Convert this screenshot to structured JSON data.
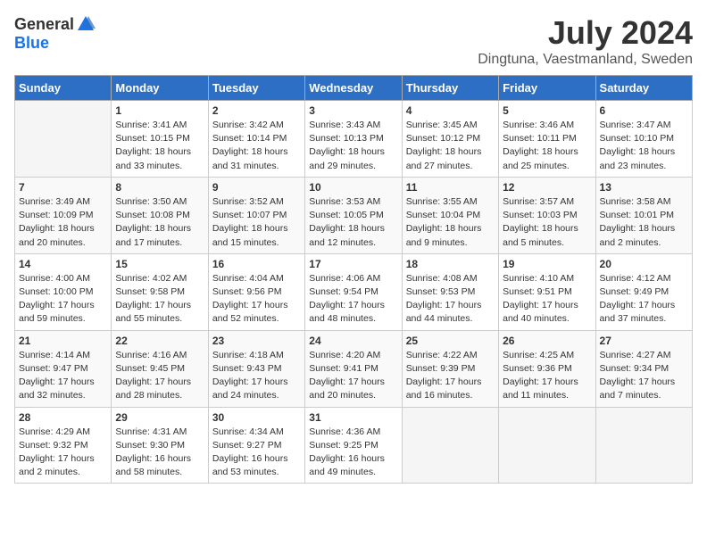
{
  "logo": {
    "general": "General",
    "blue": "Blue"
  },
  "title": "July 2024",
  "location": "Dingtuna, Vaestmanland, Sweden",
  "days_of_week": [
    "Sunday",
    "Monday",
    "Tuesday",
    "Wednesday",
    "Thursday",
    "Friday",
    "Saturday"
  ],
  "weeks": [
    [
      {
        "day": "",
        "info": ""
      },
      {
        "day": "1",
        "info": "Sunrise: 3:41 AM\nSunset: 10:15 PM\nDaylight: 18 hours\nand 33 minutes."
      },
      {
        "day": "2",
        "info": "Sunrise: 3:42 AM\nSunset: 10:14 PM\nDaylight: 18 hours\nand 31 minutes."
      },
      {
        "day": "3",
        "info": "Sunrise: 3:43 AM\nSunset: 10:13 PM\nDaylight: 18 hours\nand 29 minutes."
      },
      {
        "day": "4",
        "info": "Sunrise: 3:45 AM\nSunset: 10:12 PM\nDaylight: 18 hours\nand 27 minutes."
      },
      {
        "day": "5",
        "info": "Sunrise: 3:46 AM\nSunset: 10:11 PM\nDaylight: 18 hours\nand 25 minutes."
      },
      {
        "day": "6",
        "info": "Sunrise: 3:47 AM\nSunset: 10:10 PM\nDaylight: 18 hours\nand 23 minutes."
      }
    ],
    [
      {
        "day": "7",
        "info": "Sunrise: 3:49 AM\nSunset: 10:09 PM\nDaylight: 18 hours\nand 20 minutes."
      },
      {
        "day": "8",
        "info": "Sunrise: 3:50 AM\nSunset: 10:08 PM\nDaylight: 18 hours\nand 17 minutes."
      },
      {
        "day": "9",
        "info": "Sunrise: 3:52 AM\nSunset: 10:07 PM\nDaylight: 18 hours\nand 15 minutes."
      },
      {
        "day": "10",
        "info": "Sunrise: 3:53 AM\nSunset: 10:05 PM\nDaylight: 18 hours\nand 12 minutes."
      },
      {
        "day": "11",
        "info": "Sunrise: 3:55 AM\nSunset: 10:04 PM\nDaylight: 18 hours\nand 9 minutes."
      },
      {
        "day": "12",
        "info": "Sunrise: 3:57 AM\nSunset: 10:03 PM\nDaylight: 18 hours\nand 5 minutes."
      },
      {
        "day": "13",
        "info": "Sunrise: 3:58 AM\nSunset: 10:01 PM\nDaylight: 18 hours\nand 2 minutes."
      }
    ],
    [
      {
        "day": "14",
        "info": "Sunrise: 4:00 AM\nSunset: 10:00 PM\nDaylight: 17 hours\nand 59 minutes."
      },
      {
        "day": "15",
        "info": "Sunrise: 4:02 AM\nSunset: 9:58 PM\nDaylight: 17 hours\nand 55 minutes."
      },
      {
        "day": "16",
        "info": "Sunrise: 4:04 AM\nSunset: 9:56 PM\nDaylight: 17 hours\nand 52 minutes."
      },
      {
        "day": "17",
        "info": "Sunrise: 4:06 AM\nSunset: 9:54 PM\nDaylight: 17 hours\nand 48 minutes."
      },
      {
        "day": "18",
        "info": "Sunrise: 4:08 AM\nSunset: 9:53 PM\nDaylight: 17 hours\nand 44 minutes."
      },
      {
        "day": "19",
        "info": "Sunrise: 4:10 AM\nSunset: 9:51 PM\nDaylight: 17 hours\nand 40 minutes."
      },
      {
        "day": "20",
        "info": "Sunrise: 4:12 AM\nSunset: 9:49 PM\nDaylight: 17 hours\nand 37 minutes."
      }
    ],
    [
      {
        "day": "21",
        "info": "Sunrise: 4:14 AM\nSunset: 9:47 PM\nDaylight: 17 hours\nand 32 minutes."
      },
      {
        "day": "22",
        "info": "Sunrise: 4:16 AM\nSunset: 9:45 PM\nDaylight: 17 hours\nand 28 minutes."
      },
      {
        "day": "23",
        "info": "Sunrise: 4:18 AM\nSunset: 9:43 PM\nDaylight: 17 hours\nand 24 minutes."
      },
      {
        "day": "24",
        "info": "Sunrise: 4:20 AM\nSunset: 9:41 PM\nDaylight: 17 hours\nand 20 minutes."
      },
      {
        "day": "25",
        "info": "Sunrise: 4:22 AM\nSunset: 9:39 PM\nDaylight: 17 hours\nand 16 minutes."
      },
      {
        "day": "26",
        "info": "Sunrise: 4:25 AM\nSunset: 9:36 PM\nDaylight: 17 hours\nand 11 minutes."
      },
      {
        "day": "27",
        "info": "Sunrise: 4:27 AM\nSunset: 9:34 PM\nDaylight: 17 hours\nand 7 minutes."
      }
    ],
    [
      {
        "day": "28",
        "info": "Sunrise: 4:29 AM\nSunset: 9:32 PM\nDaylight: 17 hours\nand 2 minutes."
      },
      {
        "day": "29",
        "info": "Sunrise: 4:31 AM\nSunset: 9:30 PM\nDaylight: 16 hours\nand 58 minutes."
      },
      {
        "day": "30",
        "info": "Sunrise: 4:34 AM\nSunset: 9:27 PM\nDaylight: 16 hours\nand 53 minutes."
      },
      {
        "day": "31",
        "info": "Sunrise: 4:36 AM\nSunset: 9:25 PM\nDaylight: 16 hours\nand 49 minutes."
      },
      {
        "day": "",
        "info": ""
      },
      {
        "day": "",
        "info": ""
      },
      {
        "day": "",
        "info": ""
      }
    ]
  ]
}
